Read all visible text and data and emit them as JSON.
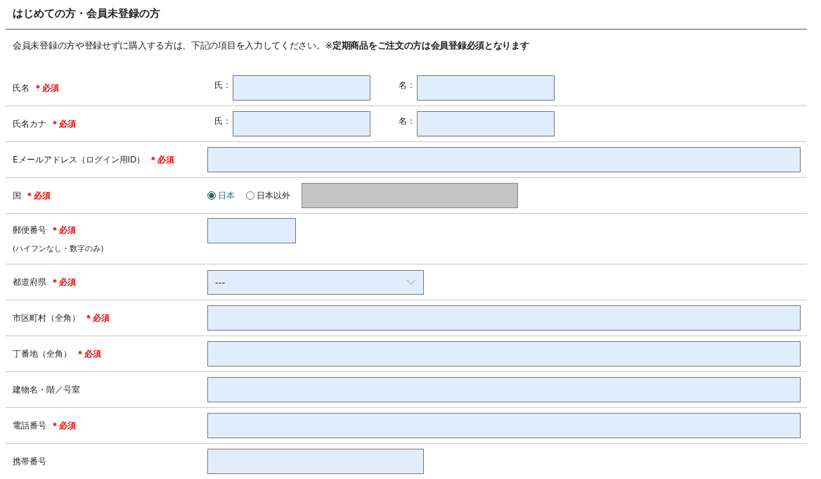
{
  "heading": "はじめての方・会員未登録の方",
  "intro": "会員未登録の方や登録せずに購入する方は、下記の項目を入力してください。※**定期商品をご注文の方は会員登録必須となります**",
  "rows": [
    {
      "kind": "name",
      "label": "氏名",
      "required_mark": "＊必須",
      "parts": [
        {
          "prefix": "氏："
        },
        {
          "prefix": "名："
        }
      ]
    },
    {
      "kind": "name",
      "label": "氏名カナ",
      "required_mark": "＊必須",
      "parts": [
        {
          "prefix": "氏："
        },
        {
          "prefix": "名："
        }
      ]
    },
    {
      "kind": "wide",
      "label": "Eメールアドレス（ログイン用ID）",
      "required_mark": "＊必須"
    },
    {
      "kind": "radio",
      "label": "国",
      "required_mark": "＊必須",
      "options": [
        {
          "label": "日本",
          "selected": true
        },
        {
          "label": "日本以外",
          "selected": false
        }
      ],
      "other_field": {
        "disabled": true
      }
    },
    {
      "kind": "short",
      "label": "郵便番号",
      "required_mark": "＊必須",
      "note": "(ハイフンなし・数字のみ)"
    },
    {
      "kind": "select",
      "label": "都道府県",
      "required_mark": "＊必須",
      "value": "---"
    },
    {
      "kind": "wide",
      "label": "市区町村（全角）",
      "required_mark": "＊必須"
    },
    {
      "kind": "wide",
      "label": "丁番地（全角）",
      "required_mark": "＊必須"
    },
    {
      "kind": "wide",
      "label": "建物名・階／号室"
    },
    {
      "kind": "wide",
      "label": "電話番号",
      "required_mark": "＊必須"
    },
    {
      "kind": "medium",
      "label": "携帯番号"
    }
  ]
}
